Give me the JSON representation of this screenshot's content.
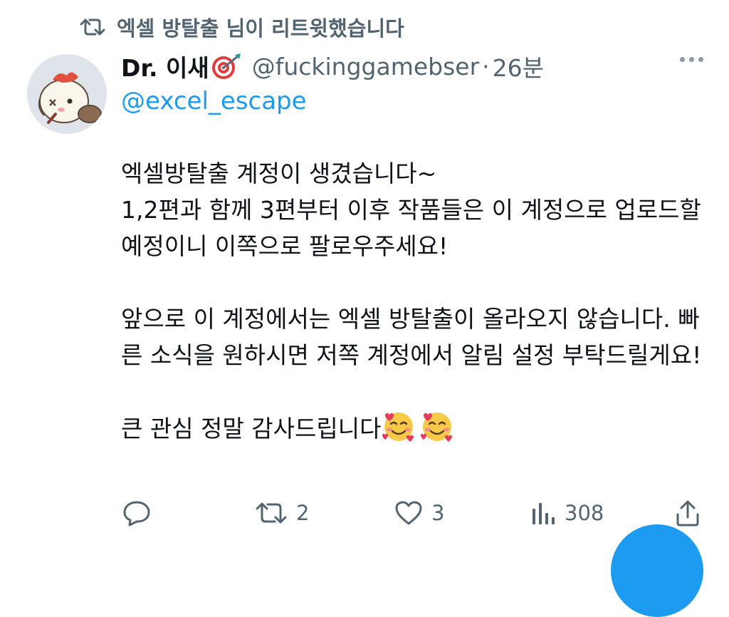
{
  "retweet_context": {
    "text": "엑셀 방탈출 님이 리트윗했습니다",
    "icon": "retweet-icon"
  },
  "author": {
    "display_name": "Dr. 이새",
    "name_emoji": "direct-hit-emoji",
    "handle": "@fuckinggamebser",
    "separator": "·",
    "time": "26분",
    "avatar": "hamster-avatar"
  },
  "tweet": {
    "mention": "@excel_escape",
    "paragraph_1": "엑셀방탈출 계정이 생겼습니다~\n1,2편과 함께 3편부터 이후 작품들은 이 계정으로 업로드할 예정이니 이쪽으로 팔로우주세요!",
    "paragraph_2": "앞으로 이 계정에서는 엑셀 방탈출이 올라오지 않습니다. 빠른 소식을 원하시면 저쪽 계정에서 알림 설정 부탁드릴게요!",
    "paragraph_3": "큰 관심 정말 감사드립니다",
    "trailing_emoji": [
      "smiling-face-with-hearts-emoji",
      "smiling-face-with-hearts-emoji"
    ]
  },
  "actions": {
    "reply": {
      "icon": "reply-icon",
      "count": ""
    },
    "retweet": {
      "icon": "retweet-icon",
      "count": "2"
    },
    "like": {
      "icon": "heart-icon",
      "count": "3"
    },
    "views": {
      "icon": "views-icon",
      "count": "308"
    },
    "share": {
      "icon": "share-icon"
    }
  },
  "colors": {
    "text": "#0f1419",
    "secondary": "#536471",
    "accent": "#1d9bf0"
  }
}
